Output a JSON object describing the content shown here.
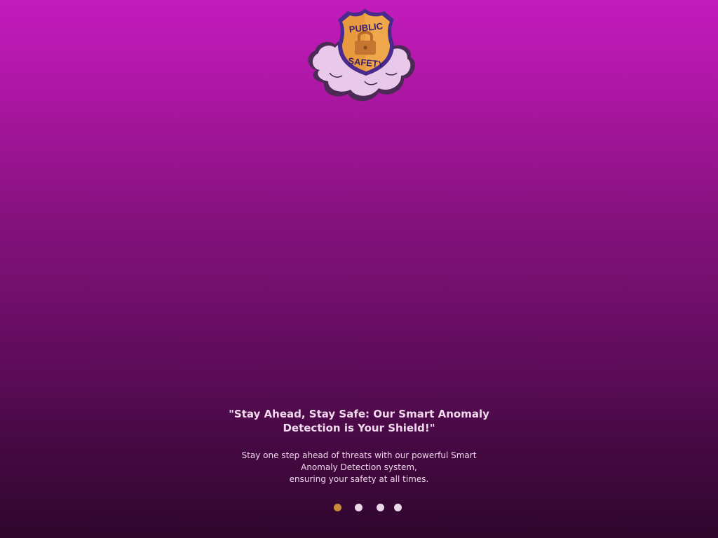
{
  "logo": {
    "line1": "PUBLIC",
    "line2": "SAFETY",
    "icon": "lock-icon"
  },
  "headline": {
    "line1": "\"Stay Ahead, Stay Safe: Our Smart Anomaly",
    "line2": "Detection is Your Shield!\""
  },
  "description": {
    "line1": "Stay one step ahead of threats with our powerful Smart",
    "line2": "Anomaly Detection system,",
    "line3": "ensuring your safety at all times."
  },
  "pagination": {
    "count": 4,
    "active_index": 0,
    "active_color": "#c98a3a",
    "inactive_color": "#e9d9e8"
  },
  "colors": {
    "background_top": "#c41bbd",
    "background_bottom": "#2e062c",
    "text": "#f0d9ec"
  }
}
